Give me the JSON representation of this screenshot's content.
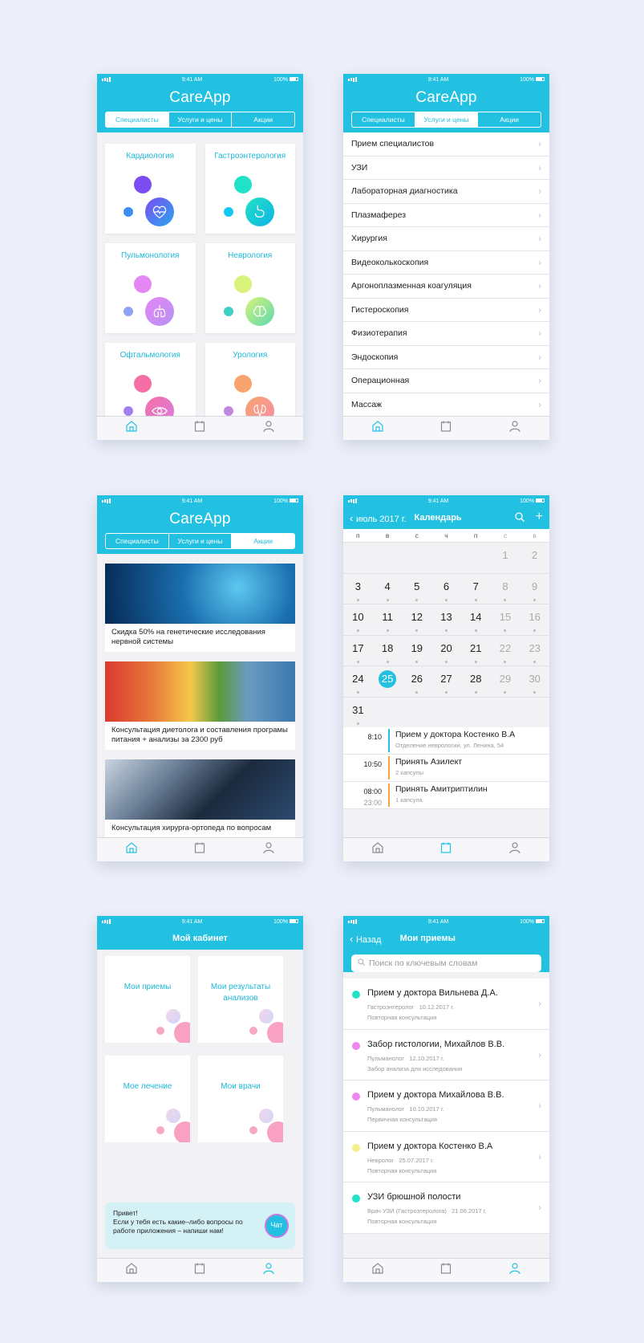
{
  "status": {
    "time": "9:41 AM",
    "battery": "100%"
  },
  "app_title": "CareApp",
  "segments": [
    "Специалисты",
    "Услуги и цены",
    "Акции"
  ],
  "specialists": [
    {
      "name": "Кардиология",
      "icon": "heart-icon",
      "colors": [
        "#7b4cf2",
        "#3b8ff0",
        "#2aa7ef"
      ]
    },
    {
      "name": "Гастроэнтерология",
      "icon": "stomach-icon",
      "colors": [
        "#21e1c6",
        "#12c8f0",
        "#0fb4e4"
      ]
    },
    {
      "name": "Пульмонология",
      "icon": "lungs-icon",
      "colors": [
        "#e586f5",
        "#8fa2f4",
        "#b692f4"
      ]
    },
    {
      "name": "Неврология",
      "icon": "brain-icon",
      "colors": [
        "#d9f27a",
        "#3ed1c4",
        "#5bd9b0"
      ]
    },
    {
      "name": "Офтальмология",
      "icon": "eye-icon",
      "colors": [
        "#f56fa4",
        "#a17ef2",
        "#d67fe0"
      ]
    },
    {
      "name": "Урология",
      "icon": "kidney-icon",
      "colors": [
        "#f9a36f",
        "#c087e2",
        "#f48ea8"
      ]
    }
  ],
  "services": [
    "Прием специалистов",
    "УЗИ",
    "Лабораторная диагностика",
    "Плазмаферез",
    "Хирургия",
    "Видеоколькоскопия",
    "Аргоноплазменная коагуляция",
    "Гистероскопия",
    "Физиотерапия",
    "Эндоскопия",
    "Операционная",
    "Массаж"
  ],
  "promos": [
    {
      "caption": "Скидка 50% на генетические исследования нервной системы"
    },
    {
      "caption": "Консультация диетолога и составления програмы питания + анализы за 2300 руб"
    },
    {
      "caption": "Консультация хирурга-ортопеда по вопросам"
    }
  ],
  "calendar": {
    "back_label": "июль 2017 г.",
    "title": "Календарь",
    "weekdays": [
      "п",
      "в",
      "с",
      "ч",
      "п",
      "с",
      "в"
    ],
    "weeks": [
      [
        "",
        "",
        "",
        "",
        "",
        "1",
        "2"
      ],
      [
        "3",
        "4",
        "5",
        "6",
        "7",
        "8",
        "9"
      ],
      [
        "10",
        "11",
        "12",
        "13",
        "14",
        "15",
        "16"
      ],
      [
        "17",
        "18",
        "19",
        "20",
        "21",
        "22",
        "23"
      ],
      [
        "24",
        "25",
        "26",
        "27",
        "28",
        "29",
        "30"
      ],
      [
        "31",
        "",
        "",
        "",
        "",
        "",
        ""
      ]
    ],
    "selected": "25",
    "events": [
      {
        "time": "8:10",
        "time2": "",
        "title": "Прием у доктора Костенко В.А",
        "sub": "Отделение неврологии, ул. Ленина, 54",
        "color": "#22c1e2"
      },
      {
        "time": "10:50",
        "time2": "",
        "title": "Принять Азилект",
        "sub": "2 капсулы",
        "color": "#f6a53c"
      },
      {
        "time": "08:00",
        "time2": "23:00",
        "title": "Принять Амитриптилин",
        "sub": "1 капсула",
        "color": "#f6a53c"
      }
    ]
  },
  "cabinet": {
    "title": "Мой кабинет",
    "tiles": [
      "Мои приемы",
      "Мои результаты анализов",
      "Мое лечение",
      "Мои врачи"
    ],
    "chat_text": "Привет!\nЕсли у тебя есть какие–либо вопросы по работе приложения – напиши нам!",
    "chat_button": "Чат"
  },
  "appointments": {
    "back_label": "Назад",
    "title": "Мои приемы",
    "search_placeholder": "Поиск по ключевым словам",
    "items": [
      {
        "title": "Прием у доктора Вильнева Д.А.",
        "meta": "Гастроэнтеролог   10.12.2017 г.",
        "type": "Повторная консультация",
        "color": "#21e1c6"
      },
      {
        "title": "Забор гистологии, Михайлов В.В.",
        "meta": "Пульманолог   12.10.2017 г.",
        "type": "Забор анализа для исследования",
        "color": "#ee86f0"
      },
      {
        "title": "Прием у доктора Михайлова В.В.",
        "meta": "Пульманолог   10.10.2017 г.",
        "type": "Первичная консультация",
        "color": "#ee86f0"
      },
      {
        "title": "Прием у доктора Костенко В.А",
        "meta": "Невролог   25.07.2017 г.",
        "type": "Повторная консультация",
        "color": "#f3ef8a"
      },
      {
        "title": "УЗИ брюшной полости",
        "meta": "Врач УЗИ (Гастроэтеролога)   21.06.2017 г.",
        "type": "Повторная консультация",
        "color": "#21e1c6"
      }
    ]
  }
}
